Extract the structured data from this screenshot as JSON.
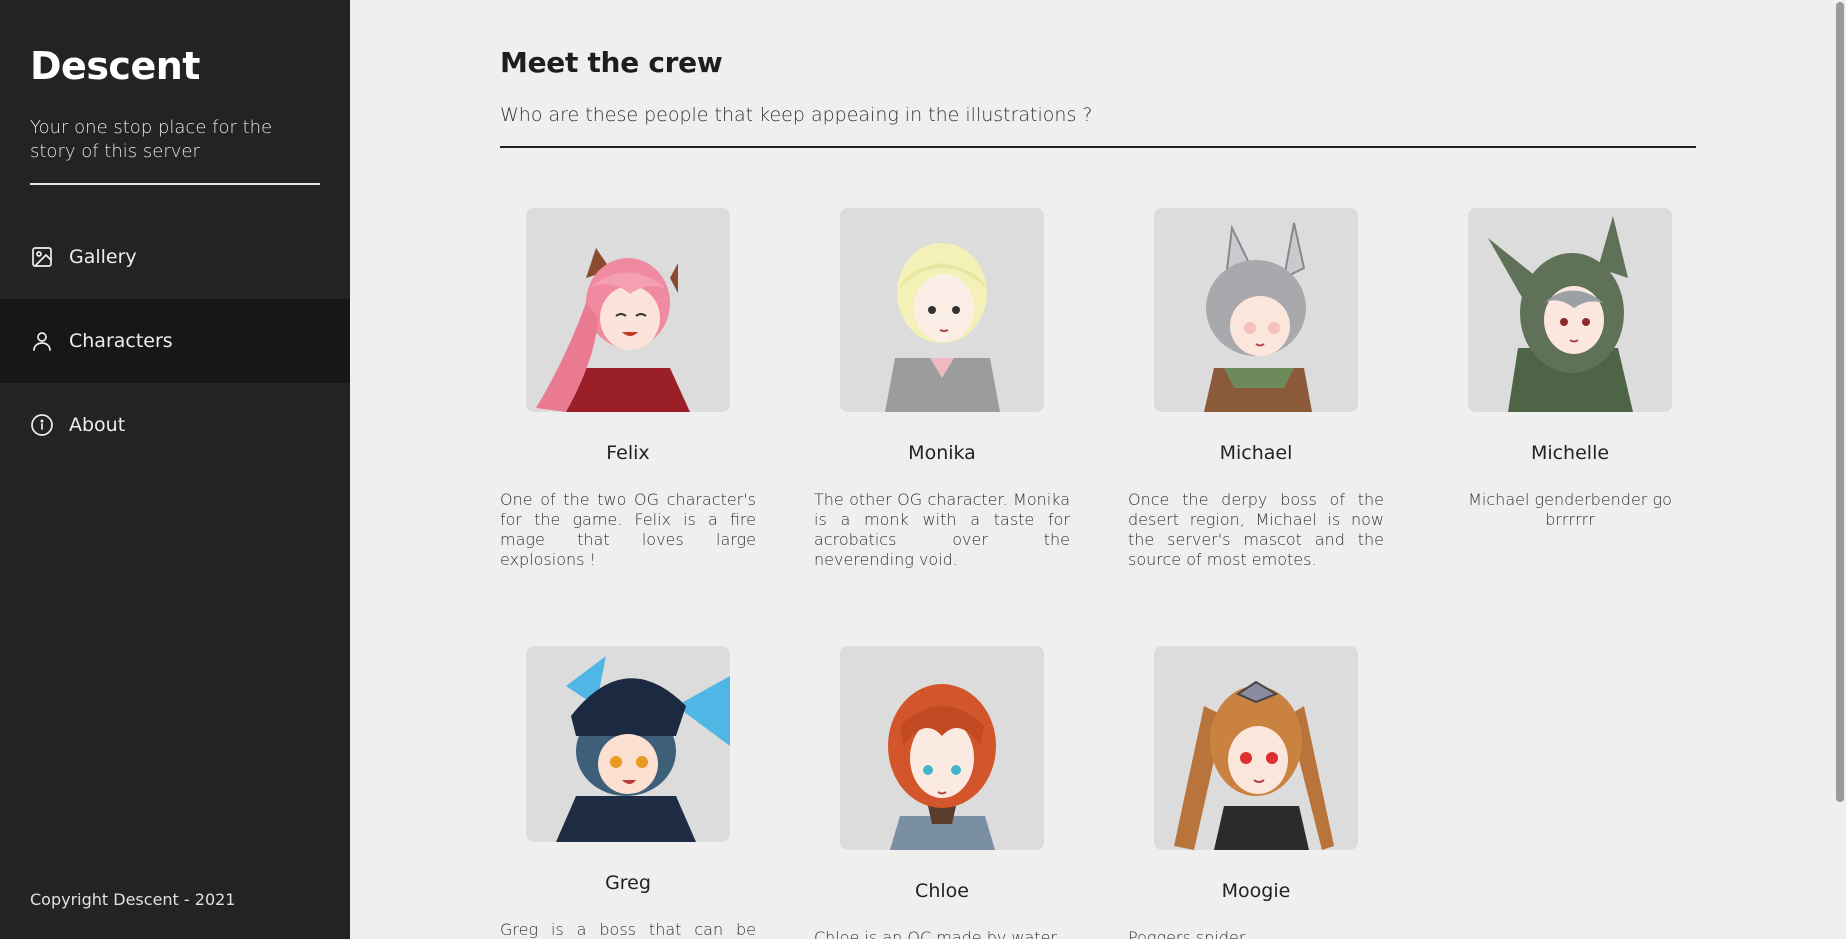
{
  "app": {
    "title": "Descent",
    "tagline": "Your one stop place for the story of this server",
    "copyright": "Copyright Descent - 2021"
  },
  "nav": [
    {
      "label": "Gallery",
      "icon": "image-icon",
      "active": false
    },
    {
      "label": "Characters",
      "icon": "user-icon",
      "active": true
    },
    {
      "label": "About",
      "icon": "info-icon",
      "active": false
    }
  ],
  "main": {
    "title": "Meet the crew",
    "subtitle": "Who are these people that keep appeaing in the illustrations ?"
  },
  "characters": [
    {
      "name": "Felix",
      "desc": "One of the two OG character's for the game. Felix is a fire mage that loves large explosions !",
      "hair": "#f08aa0",
      "accent": "#b82a2f"
    },
    {
      "name": "Monika",
      "desc": "The other OG character. Monika is a monk with a taste for acrobatics over the neverending void.",
      "hair": "#f3f1b8",
      "accent": "#9a9a9a"
    },
    {
      "name": "Michael",
      "desc": "Once the derpy boss of the desert region, Michael is now the server's mascot and the source of most emotes.",
      "hair": "#a8a8ad",
      "accent": "#6e8a5a"
    },
    {
      "name": "Michelle",
      "desc": "Michael genderbender go brrrrrr",
      "hair": "#5f7257",
      "accent": "#4e6446"
    },
    {
      "name": "Greg",
      "desc": "Greg is a boss that can be found",
      "hair": "#3e5f78",
      "accent": "#1e2d44"
    },
    {
      "name": "Chloe",
      "desc": "Chloe is an OC made by water",
      "hair": "#d3552b",
      "accent": "#7a8fa3"
    },
    {
      "name": "Moogie",
      "desc": "Poggers spider",
      "hair": "#c9823f",
      "accent": "#2b2b2b"
    }
  ],
  "colors": {
    "sidebar_bg": "#232323",
    "sidebar_active": "#171717",
    "page_bg": "#efefef",
    "portrait_bg": "#dcdcdc"
  }
}
